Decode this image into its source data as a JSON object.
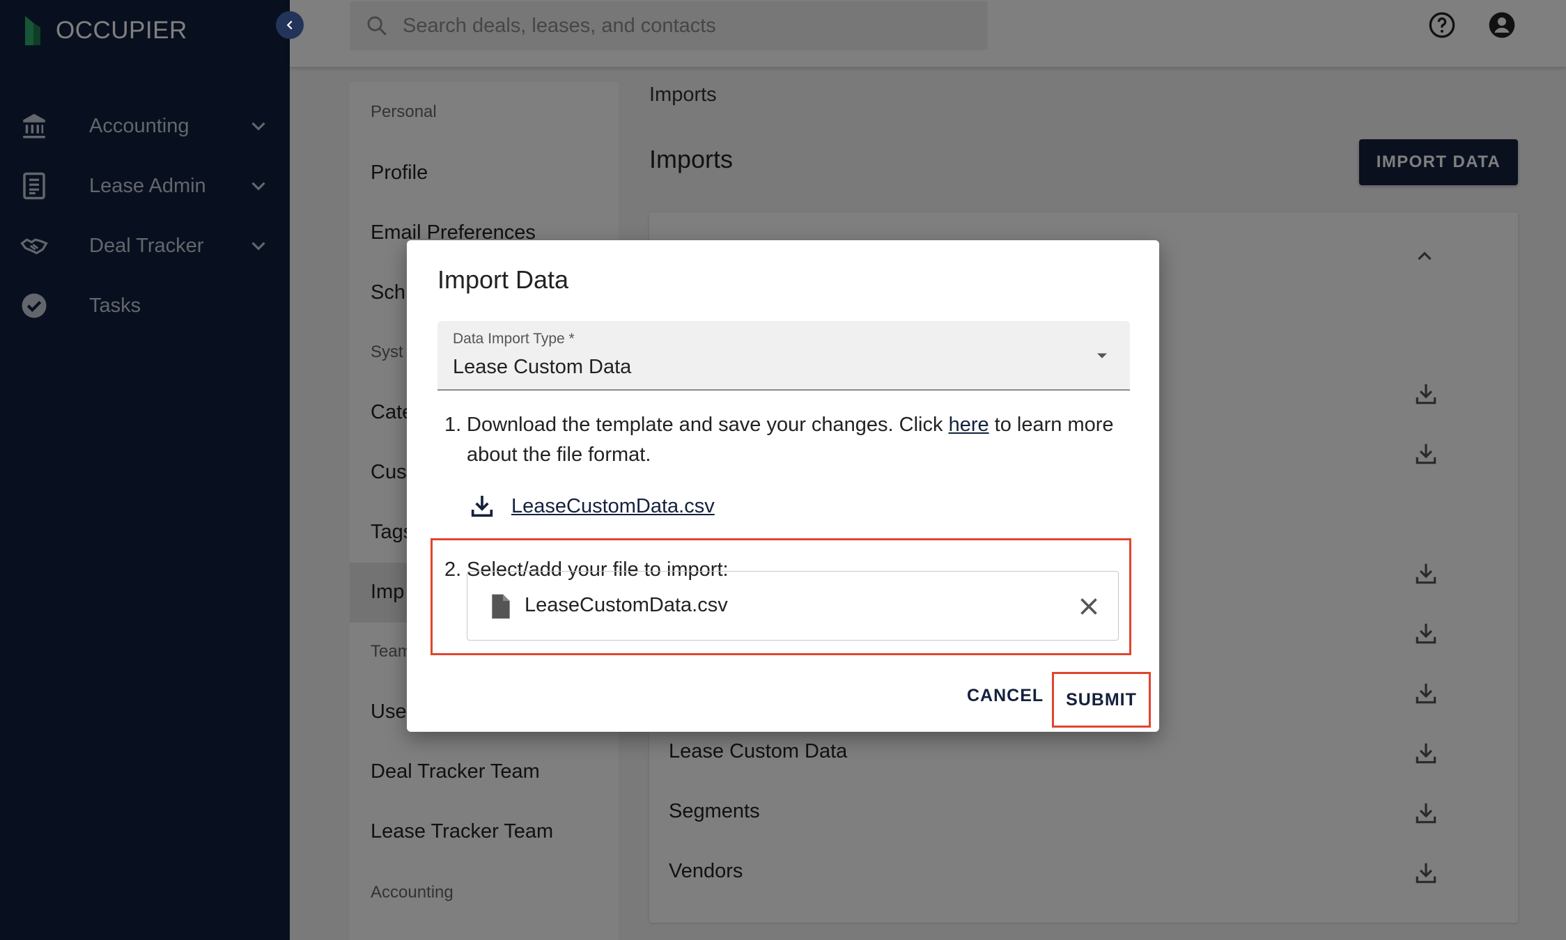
{
  "app": {
    "name": "OCCUPIER"
  },
  "sidebar": {
    "items": [
      {
        "label": "Accounting",
        "icon": "bank-icon",
        "expandable": true
      },
      {
        "label": "Lease Admin",
        "icon": "document-icon",
        "expandable": true
      },
      {
        "label": "Deal Tracker",
        "icon": "handshake-icon",
        "expandable": true
      },
      {
        "label": "Tasks",
        "icon": "check-circle-icon",
        "expandable": false
      }
    ]
  },
  "topbar": {
    "search_placeholder": "Search deals, leases, and contacts",
    "icons": [
      "help-icon",
      "account-icon"
    ]
  },
  "settings_nav": {
    "items": [
      "Personal",
      "Profile",
      "Email Preferences",
      "Sch",
      "Syst",
      "Cate",
      "Cus",
      "Tags",
      "Imp",
      "Team",
      "User",
      "Deal Tracker Team",
      "Lease Tracker Team",
      "Accounting"
    ]
  },
  "main": {
    "breadcrumb": "Imports",
    "title": "Imports",
    "import_button": "IMPORT DATA",
    "rows": [
      {
        "label": "Lease Custom Data"
      },
      {
        "label": "Segments"
      },
      {
        "label": "Vendors"
      }
    ]
  },
  "dialog": {
    "title": "Import Data",
    "select_label": "Data Import Type *",
    "select_value": "Lease Custom Data",
    "step1_num": "1.",
    "step1_text_a": "Download the template and save your changes. Click ",
    "step1_link": "here",
    "step1_text_b": " to learn more",
    "step1_text_c": "about the file format.",
    "template_file": "LeaseCustomData.csv",
    "step2_num": "2.",
    "step2_text": "Select/add your file to import:",
    "selected_file": "LeaseCustomData.csv",
    "cancel_label": "CANCEL",
    "submit_label": "SUBMIT"
  },
  "colors": {
    "sidebar_bg": "#10203f",
    "primary": "#14213d",
    "highlight": "#e0452e"
  }
}
